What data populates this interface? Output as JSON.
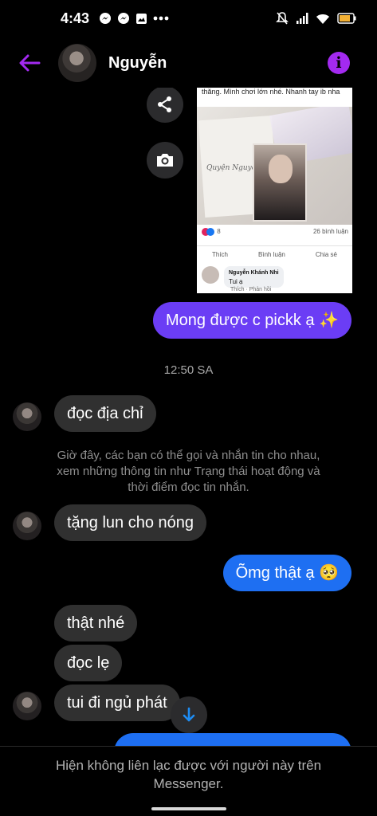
{
  "status_bar": {
    "time": "4:43",
    "icons_left": [
      "messenger-icon",
      "messenger-icon",
      "gallery-icon",
      "more-dots-icon"
    ],
    "icons_right": [
      "mute-icon",
      "signal-icon",
      "wifi-icon",
      "battery-icon"
    ]
  },
  "header": {
    "contact_name": "Nguyễn",
    "accent_color": "#a32af0"
  },
  "shared_post": {
    "caption": "thăng. Mình chơi lớn nhé. Nhanh tay ib nha",
    "signature": "Quyện Nguyệt",
    "comment_count": "26 bình luận",
    "reaction_count": "8",
    "actions": [
      "Thích",
      "Bình luận",
      "Chia sẻ"
    ],
    "comment": {
      "author": "Nguyễn Khánh Nhi",
      "text": "Tui ạ",
      "actions": "Thích · Phản hồi"
    }
  },
  "messages": [
    {
      "direction": "out",
      "text": "Mong được c pickk ạ ✨"
    },
    {
      "direction": "in",
      "text": "đọc địa chỉ"
    },
    {
      "direction": "in",
      "text": "tặng lun cho nóng"
    },
    {
      "direction": "out",
      "text": "Õmg thật ạ 🥺"
    },
    {
      "direction": "in",
      "text": "thật nhé"
    },
    {
      "direction": "in",
      "text": "đọc lẹ"
    },
    {
      "direction": "in",
      "text": "tui đi ngủ phát"
    }
  ],
  "timestamp": "12:50 SA",
  "system_note": "Giờ đây, các bạn có thể gọi và nhắn tin cho nhau, xem những thông tin như Trạng thái hoạt động và thời điểm đọc tin nhắn.",
  "footer": {
    "notice": "Hiện không liên lạc được với người này trên Messenger."
  },
  "colors": {
    "outgoing_bubble": "#6b3df5",
    "outgoing_bubble_blue": "#1e6ff2",
    "incoming_bubble": "#303030",
    "background": "#000000"
  }
}
